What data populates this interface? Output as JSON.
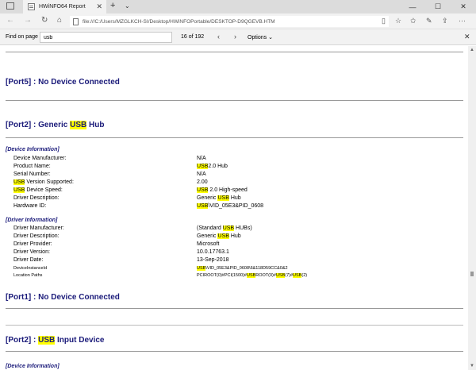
{
  "browser": {
    "tab_title": "HWiNFO64 Report",
    "tab_close": "✕",
    "new_tab": "+",
    "tab_menu": "⌄",
    "win_min": "—",
    "win_max": "☐",
    "win_close": "✕",
    "url": "file:///C:/Users/MZGLKCH-SI/Desktop/HWiNFOPortable/DESKTOP-D9QGEVB.HTM"
  },
  "find": {
    "label": "Find on page",
    "query": "usb",
    "count": "16 of 192",
    "options_label": "Options",
    "options_chevron": "⌄"
  },
  "content": {
    "port5_title": {
      "prefix": "[Port5] : No Device Connected"
    },
    "port2_hub_title": {
      "prefix": "[Port2] : Generic ",
      "hl": "USB",
      "suffix": " Hub"
    },
    "device_info_label": "[Device Information]",
    "device_rows": [
      {
        "label_pre": "Device Manufacturer:",
        "label_hl": "",
        "label_post": "",
        "value_hl": "",
        "value_post": "N/A"
      },
      {
        "label_pre": "Product Name:",
        "label_hl": "",
        "label_post": "",
        "value_hl": "USB",
        "value_post": "2.0 Hub"
      },
      {
        "label_pre": "Serial Number:",
        "label_hl": "",
        "label_post": "",
        "value_hl": "",
        "value_post": "N/A"
      },
      {
        "label_pre": "",
        "label_hl": "USB",
        "label_post": " Version Supported:",
        "value_hl": "",
        "value_post": "2.00"
      },
      {
        "label_pre": "",
        "label_hl": "USB",
        "label_post": " Device Speed:",
        "value_hl": "USB",
        "value_post": " 2.0 High-speed"
      },
      {
        "label_pre": "Driver Description:",
        "label_hl": "",
        "label_post": "",
        "value_pre": "Generic ",
        "value_hl": "USB",
        "value_post": " Hub"
      },
      {
        "label_pre": "Hardware ID:",
        "label_hl": "",
        "label_post": "",
        "value_hl": "USB",
        "value_post": "\\VID_05E3&PID_0608"
      }
    ],
    "driver_info_label": "[Driver Information]",
    "driver_rows": [
      {
        "label": "Driver Manufacturer:",
        "value": "(Standard USB HUBs)"
      },
      {
        "label": "Driver Description:",
        "value": "Generic USB Hub"
      },
      {
        "label": "Driver Provider:",
        "value": "Microsoft"
      },
      {
        "label": "Driver Version:",
        "value": "10.0.17763.1"
      },
      {
        "label": "Driver Date:",
        "value": "13-Sep-2018"
      },
      {
        "label": "DeviceInstanceId",
        "value": "USB\\VID_05E3&PID_0608\\6&118D59CC&0&2"
      },
      {
        "label": "Location Paths",
        "value": "PCIROOT(0)#PCI(1500)#USBROOT(0)#USB(7)#USB(2)"
      }
    ],
    "port1_title": "[Port1] : No Device Connected",
    "port2_input_title": {
      "prefix": "[Port2] : ",
      "hl": "USB",
      "suffix": " Input Device"
    },
    "device_info_label_2": "[Device Information]"
  },
  "colors": {
    "heading": "#1b1b7a",
    "highlight": "#ffff00"
  }
}
